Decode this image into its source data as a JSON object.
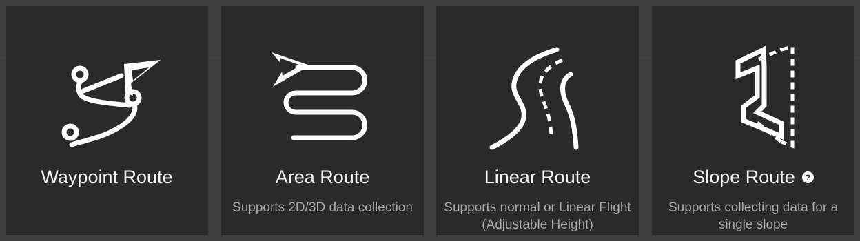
{
  "routes": [
    {
      "id": "waypoint",
      "title": "Waypoint Route",
      "description": "",
      "icon": "waypoint-route-icon"
    },
    {
      "id": "area",
      "title": "Area Route",
      "description": "Supports 2D/3D data collection",
      "icon": "area-route-icon"
    },
    {
      "id": "linear",
      "title": "Linear Route",
      "description": "Supports normal or Linear Flight (Adjustable Height)",
      "icon": "linear-route-icon"
    },
    {
      "id": "slope",
      "title": "Slope Route",
      "description": "Supports collecting data for a single slope",
      "icon": "slope-route-icon",
      "help_icon": "?"
    }
  ],
  "colors": {
    "background": "#3e3e3e",
    "card": "#2a2a2a",
    "title": "#f5f5f5",
    "description": "#a9a9a9"
  }
}
